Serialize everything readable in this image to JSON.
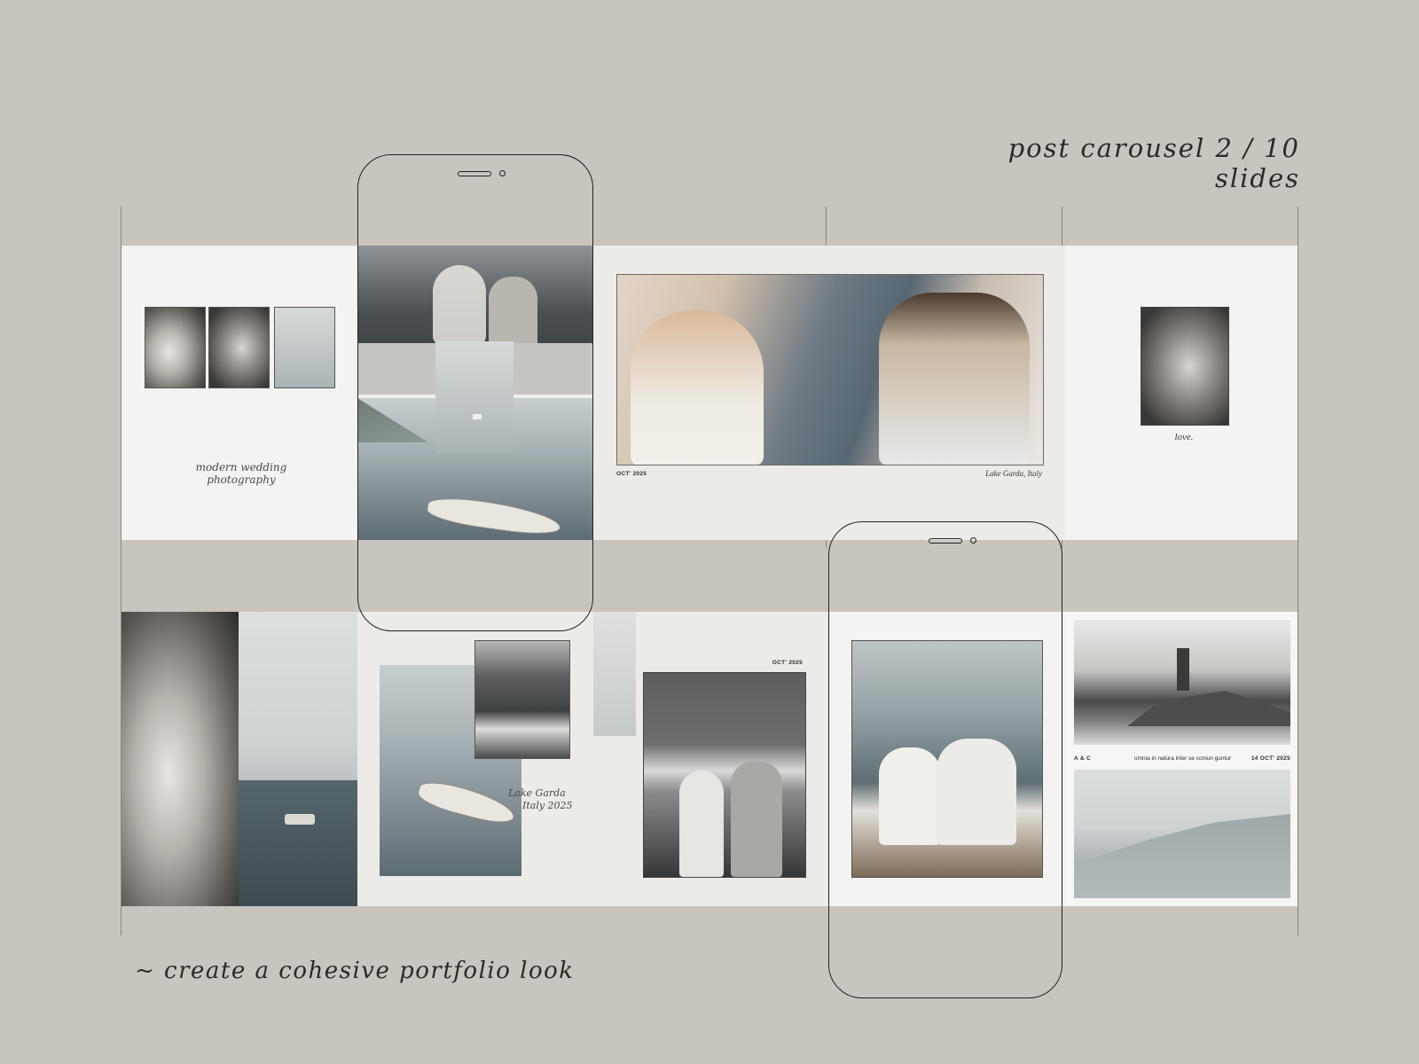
{
  "heading": "post carousel 2 / 10 slides",
  "tagline": "~ create a cohesive portfolio look",
  "carousel_top": {
    "slide1_script": "modern wedding photography",
    "spread_date": "OCT' 2025",
    "spread_location": "Lake Garda, Italy",
    "slide5_caption": "love."
  },
  "carousel_bottom": {
    "script_location_line1": "Lake Garda",
    "script_location_line2": "Italy 2025",
    "date_label": "OCT' 2025",
    "footer_left": "A & C",
    "footer_center": "omnia in natura inter se coniun guntur",
    "footer_right": "14 OCT' 2025"
  },
  "colors": {
    "background": "#c9c4bd",
    "slide_white": "#f4f3f1",
    "slide_grey": "#ecebe7",
    "outline": "#222222"
  }
}
